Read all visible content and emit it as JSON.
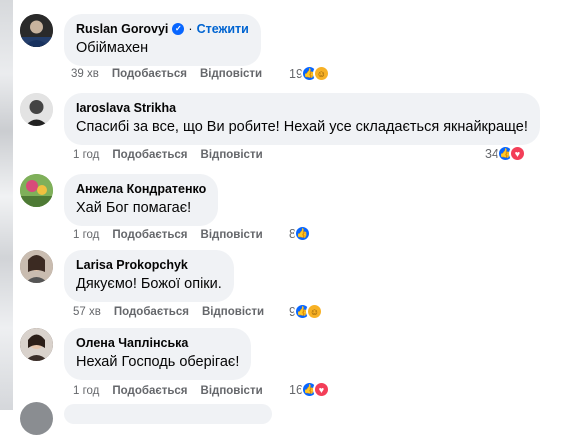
{
  "labels": {
    "like": "Подобається",
    "reply": "Відповісти",
    "follow": "Стежити",
    "separator": "·"
  },
  "comments": [
    {
      "author": "Ruslan Gorovyi",
      "verified": true,
      "text": "Обіймахен",
      "time": "39 хв",
      "count": "19",
      "reactions": [
        "like",
        "care"
      ],
      "avatar_color": "#2a2a2a"
    },
    {
      "author": "Iaroslava Strikha",
      "verified": false,
      "text": "Спасибі за все, що Ви робите! Нехай усе складається якнайкраще!",
      "time": "1 год",
      "count": "34",
      "reactions": [
        "like",
        "love"
      ],
      "avatar_color": "#555555"
    },
    {
      "author": "Анжела Кондратенко",
      "verified": false,
      "text": "Хай Бог помагає!",
      "time": "1 год",
      "count": "8",
      "reactions": [
        "like"
      ],
      "avatar_color": "#6f9a4f"
    },
    {
      "author": "Larisa Prokopchyk",
      "verified": false,
      "text": "Дякуємо! Божої опіки.",
      "time": "57 хв",
      "count": "9",
      "reactions": [
        "like",
        "care"
      ],
      "avatar_color": "#8c7b6e"
    },
    {
      "author": "Олена Чаплінська",
      "verified": false,
      "text": "Нехай Господь оберігає!",
      "time": "1 год",
      "count": "16",
      "reactions": [
        "like",
        "love"
      ],
      "avatar_color": "#5a4a42"
    }
  ],
  "colors": {
    "like": "#0866ff",
    "love": "#f33e58",
    "care": "#f7b125",
    "bubble": "#f0f2f5",
    "meta": "#65676b",
    "follow": "#0064d1"
  }
}
